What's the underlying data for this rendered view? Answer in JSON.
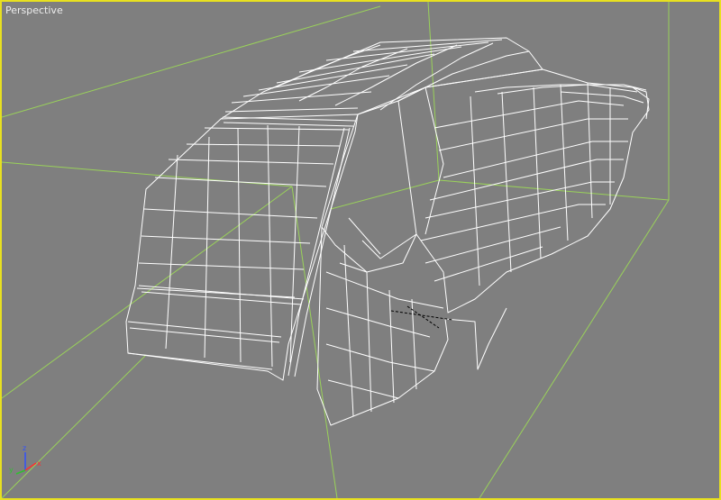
{
  "viewport": {
    "label": "Perspective",
    "mode": "wireframe",
    "background_color": "#7f7f7f",
    "active_border_color": "#e8e020",
    "wire_color": "#ffffff",
    "grid_color": "#9ad25a"
  },
  "axis_gizmo": {
    "x_label": "x",
    "y_label": "y",
    "z_label": "z",
    "x_color": "#ff3030",
    "y_color": "#30c030",
    "z_color": "#3050ff"
  }
}
